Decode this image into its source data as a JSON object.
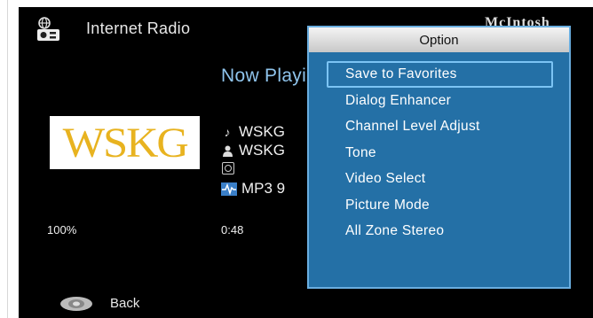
{
  "header": {
    "title": "Internet Radio",
    "brand": "McIntosh",
    "icon": "internet-radio-icon"
  },
  "now_playing": {
    "heading": "Now Playing",
    "logo_text": "WSKG",
    "station": "WSKG",
    "artist": "WSKG",
    "format": "MP3  9",
    "buffer": "100%",
    "elapsed": "0:48"
  },
  "footer": {
    "back_label": "Back",
    "back_icon": "remote-button-icon"
  },
  "option_menu": {
    "title": "Option",
    "items": [
      {
        "label": "Save to Favorites",
        "selected": true
      },
      {
        "label": "Dialog Enhancer"
      },
      {
        "label": "Channel Level Adjust"
      },
      {
        "label": "Tone"
      },
      {
        "label": "Video Select"
      },
      {
        "label": "Picture Mode"
      },
      {
        "label": "All Zone Stereo"
      }
    ]
  },
  "colors": {
    "menu_bg": "#2470a6",
    "menu_border": "#6aaee0",
    "highlight": "#8fc4ec",
    "logo_gold": "#e8b320"
  }
}
